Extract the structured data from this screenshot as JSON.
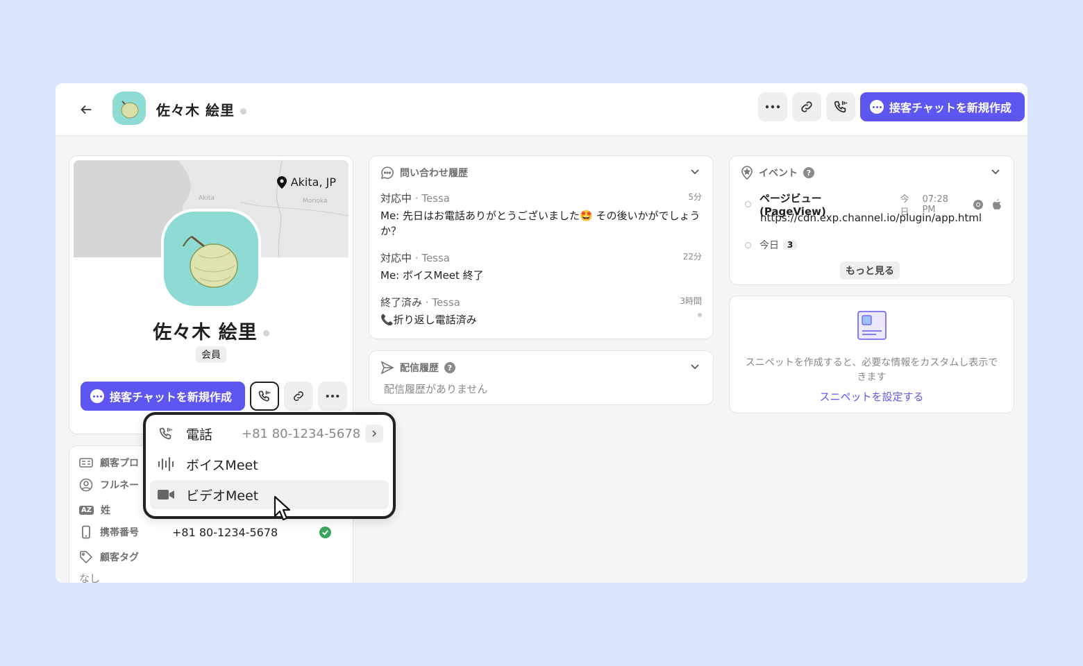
{
  "header": {
    "name": "佐々木 絵里",
    "new_chat_label": "接客チャットを新規作成"
  },
  "profile": {
    "location": "Akita, JP",
    "map_labels": [
      "Akita",
      "Morioka"
    ],
    "name": "佐々木 絵里",
    "badge": "会員",
    "new_chat_label": "接客チャットを新規作成"
  },
  "call_menu": {
    "items": [
      {
        "label": "電話",
        "value": "+81 80-1234-5678",
        "icon": "phone-icon"
      },
      {
        "label": "ボイスMeet",
        "icon": "voice-wave-icon"
      },
      {
        "label": "ビデオMeet",
        "icon": "video-camera-icon"
      }
    ]
  },
  "attributes": {
    "section_title": "顧客プロ",
    "rows": [
      {
        "label": "フルネー",
        "icon": "user-circle-icon"
      },
      {
        "label": "姓",
        "icon": "az-icon"
      },
      {
        "label": "携帯番号",
        "value": "+81 80-1234-5678",
        "icon": "mobile-icon",
        "verified": true
      },
      {
        "label": "顧客タグ",
        "icon": "tag-icon"
      }
    ],
    "tag_value": "なし"
  },
  "inquiry_history": {
    "title": "問い合わせ履歴",
    "items": [
      {
        "status": "対応中",
        "who": "· Tessa",
        "time": "5分",
        "message": "Me: 先日はお電話ありがとうございました🤩 その後いかがでしょうか？"
      },
      {
        "status": "対応中",
        "who": "· Tessa",
        "time": "22分",
        "message": "Me: ボイスMeet 終了"
      },
      {
        "status": "終了済み",
        "who": "· Tessa",
        "time": "3時間",
        "message": "📞折り返し電話済み"
      }
    ]
  },
  "delivery_history": {
    "title": "配信履歴",
    "empty": "配信履歴がありません"
  },
  "events": {
    "title": "イベント",
    "items": [
      {
        "name": "ページビュー (PageView)",
        "day": "今日",
        "time": "07:28 PM",
        "url": "https://cdn.exp.channel.io/plugin/app.html"
      },
      {
        "name": "今日",
        "count": "3"
      }
    ],
    "more_label": "もっと見る"
  },
  "snippet": {
    "description": "スニペットを作成すると、必要な情報をカスタムし表示できます",
    "link": "スニペットを設定する"
  },
  "colors": {
    "accent": "#5e56f0",
    "background": "#d9e6fe",
    "avatar_bg": "#8edbd4",
    "verified": "#3aa55d"
  }
}
